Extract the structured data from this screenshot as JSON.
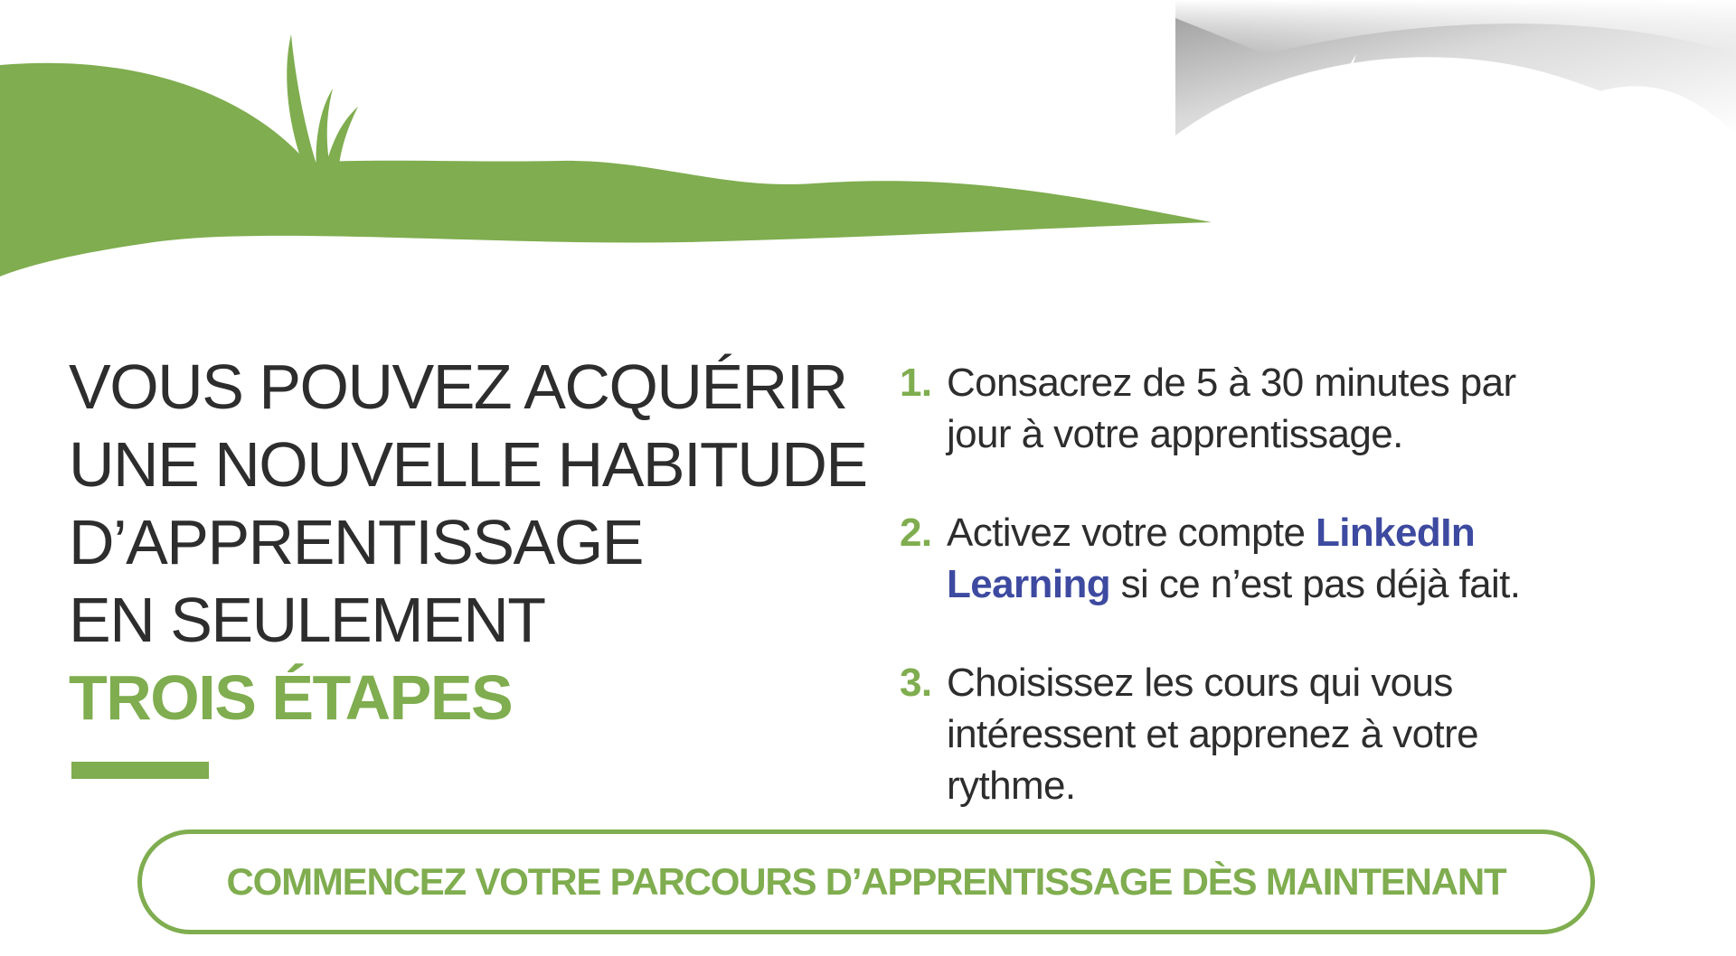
{
  "colors": {
    "accent_green": "#7fad4f",
    "link_blue": "#3d4aa0",
    "text_dark": "#2d2d2d"
  },
  "headline": {
    "line1": "VOUS POUVEZ ACQUÉRIR",
    "line2": "UNE NOUVELLE HABITUDE",
    "line3": "D’APPRENTISSAGE",
    "line4": "EN SEULEMENT",
    "accent": "TROIS ÉTAPES"
  },
  "steps": [
    {
      "number": "1.",
      "text": "Consacrez de 5 à 30 minutes par jour à votre apprentissage."
    },
    {
      "number": "2.",
      "text_before": "Activez votre compte ",
      "link": "LinkedIn Learning",
      "text_after": " si ce n’est pas déjà fait."
    },
    {
      "number": "3.",
      "text": "Choisissez les cours qui vous intéressent et apprenez à votre rythme."
    }
  ],
  "cta": {
    "label": "COMMENCEZ VOTRE PARCOURS D’APPRENTISSAGE DÈS MAINTENANT"
  }
}
